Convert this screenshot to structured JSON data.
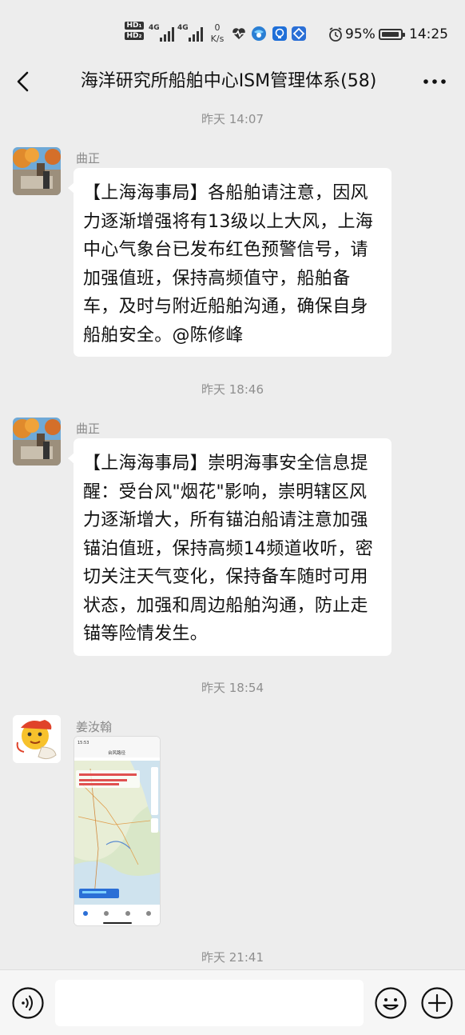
{
  "status_bar": {
    "hd1": "HD₁",
    "hd2": "HD₂",
    "net1": "4G",
    "net2": "4G",
    "speed_value": "0",
    "speed_unit": "K/s",
    "battery_pct": "95%",
    "battery_level": 0.95,
    "time": "14:25"
  },
  "header": {
    "title": "海洋研究所船舶中心ISM管理体系(58)"
  },
  "messages": [
    {
      "time": "昨天 14:07",
      "sender": "曲正",
      "text": "【上海海事局】各船舶请注意，因风力逐渐增强将有13级以上大风，上海中心气象台已发布红色预警信号，请加强值班，保持高频值守，船舶备车，及时与附近船舶沟通，确保自身船舶安全。@陈修峰"
    },
    {
      "time": "昨天 18:46",
      "sender": "曲正",
      "text": "【上海海事局】崇明海事安全信息提醒：受台风\"烟花\"影响，崇明辖区风力逐渐增大，所有锚泊船请注意加强锚泊值班，保持高频14频道收听，密切关注天气变化，保持备车随时可用状态，加强和周边船舶沟通，防止走锚等险情发生。"
    },
    {
      "time": "昨天 18:54",
      "sender": "姜汝翰",
      "image_title": "台风路径"
    },
    {
      "time": "昨天 21:41"
    }
  ],
  "input": {
    "placeholder": ""
  },
  "icons": {
    "back": "chevron-left-icon",
    "more": "more-dots-icon",
    "voice": "voice-icon",
    "emoji": "emoji-icon",
    "plus": "plus-icon"
  }
}
